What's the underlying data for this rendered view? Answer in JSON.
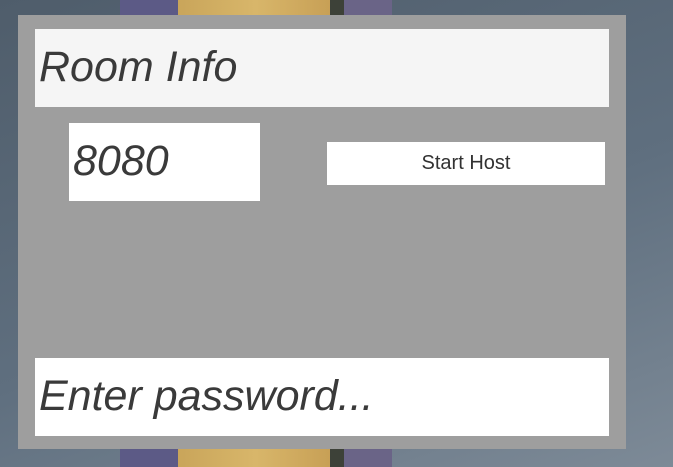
{
  "room_info": {
    "title": "Room Info"
  },
  "port_field": {
    "value": "8080"
  },
  "start_host": {
    "label": "Start Host"
  },
  "password_field": {
    "placeholder": "Enter password..."
  },
  "colors": {
    "panel": "#9e9e9e",
    "field_bg": "#ffffff",
    "header_bg": "#f5f5f5",
    "text": "#3a3a3a"
  }
}
